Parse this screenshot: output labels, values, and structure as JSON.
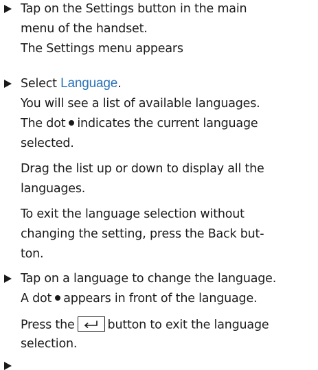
{
  "steps": [
    {
      "lines": [
        "Tap on the Settings button in the main",
        "menu of the handset.",
        "The Settings menu appears"
      ]
    },
    {
      "prefix": "Select ",
      "keyword": "Language",
      "suffix": ".",
      "lines": [
        "You will see a list of available languages."
      ],
      "dot_prefix": "The dot",
      "dot_suffix": "indicates the current language",
      "lines2": [
        "selected.",
        "Drag the list up or down to display all the",
        "languages.",
        "To exit the language selection without",
        "changing the setting, press the Back but-",
        "ton."
      ]
    },
    {
      "lines": [
        "Tap on a language to change the language."
      ],
      "dot_prefix": "A dot",
      "dot_suffix": "appears in front of the language.",
      "key_prefix": "Press the",
      "key_icon": "back-key-icon",
      "key_suffix": "button to exit the language",
      "key_line2": "selection."
    }
  ],
  "colors": {
    "text": "#1a1a1a",
    "keyword": "#2a72b8"
  }
}
